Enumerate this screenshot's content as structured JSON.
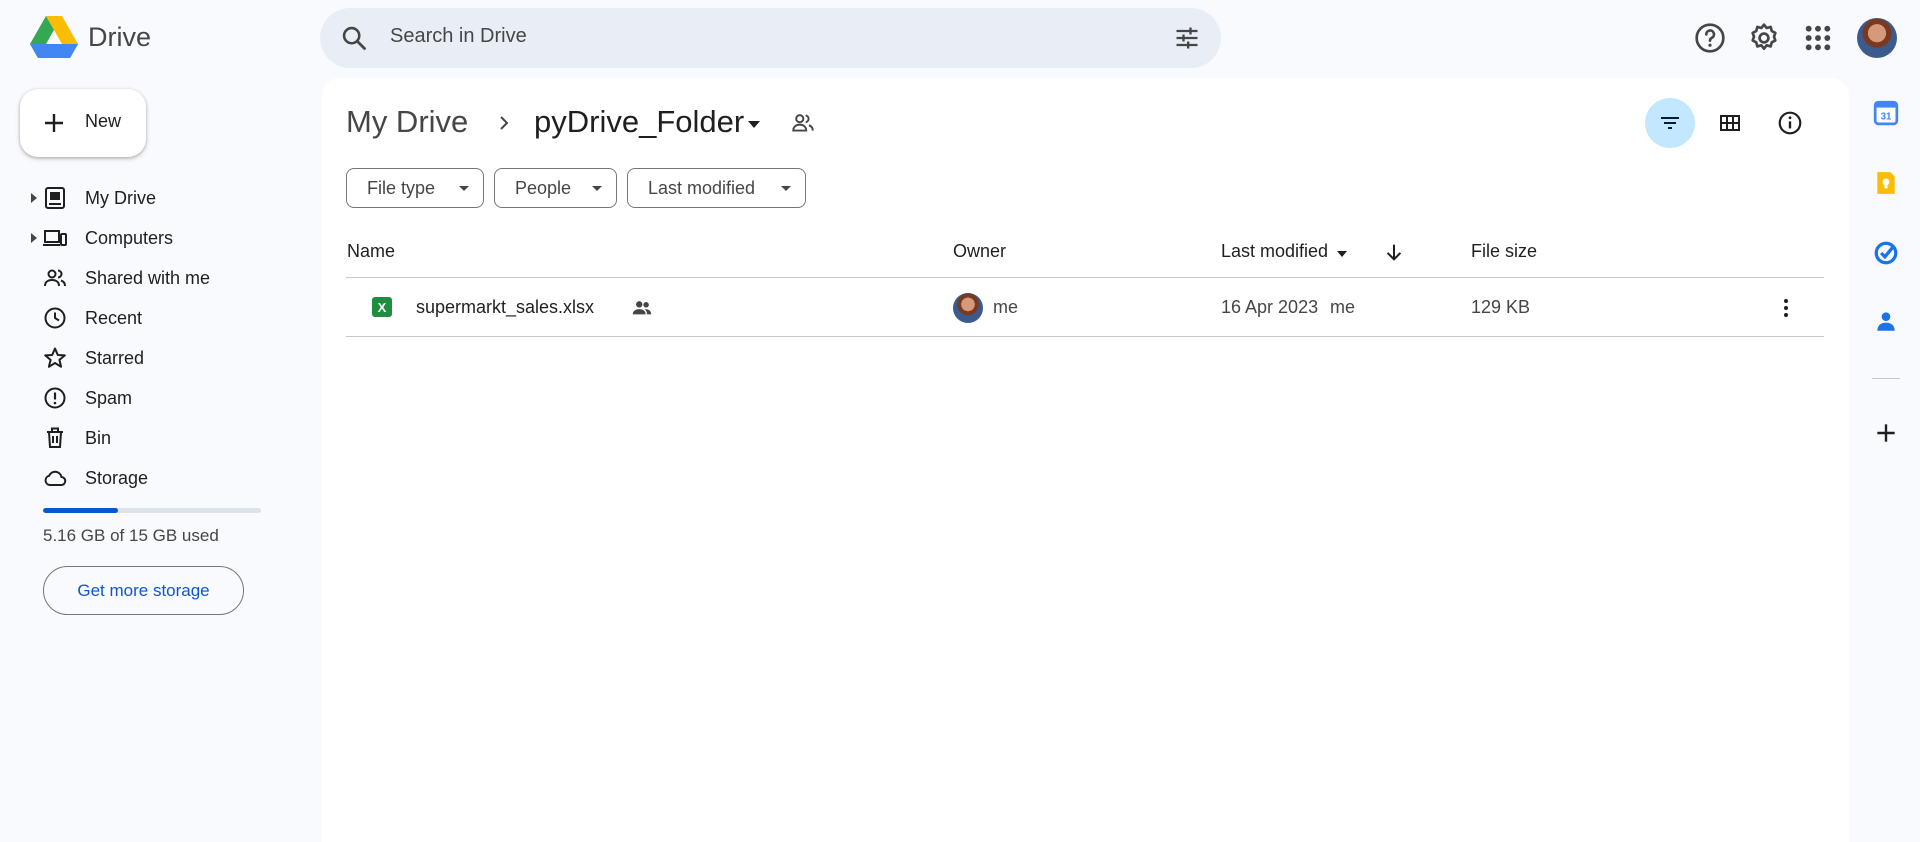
{
  "app": {
    "name": "Drive",
    "search_placeholder": "Search in Drive"
  },
  "new_button": {
    "label": "New"
  },
  "sidebar": {
    "items": [
      {
        "label": "My Drive",
        "icon": "my-drive-icon",
        "expandable": true
      },
      {
        "label": "Computers",
        "icon": "computers-icon",
        "expandable": true
      },
      {
        "label": "Shared with me",
        "icon": "shared-with-me-icon",
        "expandable": false
      },
      {
        "label": "Recent",
        "icon": "clock-icon",
        "expandable": false
      },
      {
        "label": "Starred",
        "icon": "star-icon",
        "expandable": false
      },
      {
        "label": "Spam",
        "icon": "spam-icon",
        "expandable": false
      },
      {
        "label": "Bin",
        "icon": "trash-icon",
        "expandable": false
      },
      {
        "label": "Storage",
        "icon": "cloud-icon",
        "expandable": false
      }
    ],
    "storage": {
      "used_text": "5.16 GB of 15 GB used",
      "fraction_used": 0.344,
      "cta": "Get more storage"
    }
  },
  "breadcrumb": {
    "root": "My Drive",
    "current": "pyDrive_Folder"
  },
  "filters": {
    "file_type": "File type",
    "people": "People",
    "last_modified": "Last modified"
  },
  "table": {
    "headers": {
      "name": "Name",
      "owner": "Owner",
      "last_modified": "Last modified",
      "file_size": "File size"
    },
    "rows": [
      {
        "icon_letter": "X",
        "name": "supermarkt_sales.xlsx",
        "shared": true,
        "owner": "me",
        "modified_date": "16 Apr 2023",
        "modified_by": "me",
        "size": "129 KB"
      }
    ]
  },
  "colors": {
    "accent": "#0b57d0",
    "active_chip": "#c2e7ff",
    "excel_green": "#1e8e3e"
  }
}
